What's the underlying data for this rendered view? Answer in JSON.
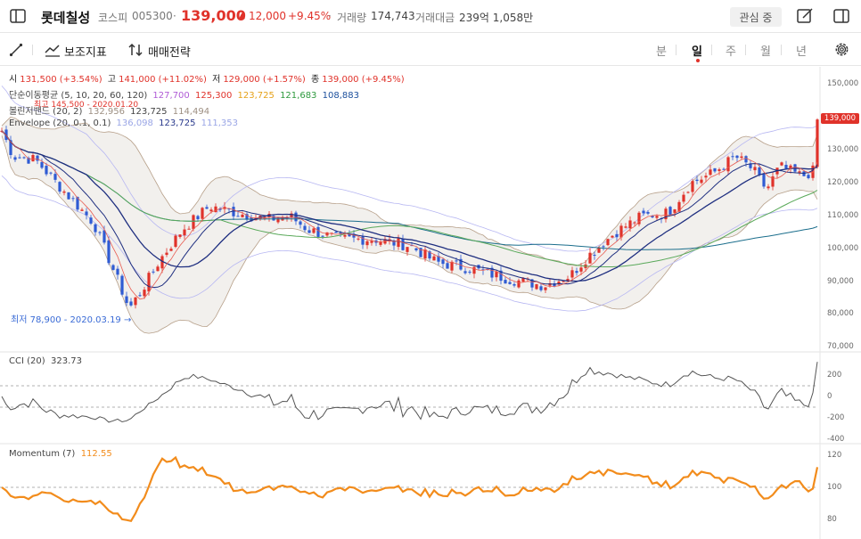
{
  "header": {
    "stock_name": "롯데칠성",
    "market": "코스피",
    "code": "005300",
    "separator": "·",
    "price": "139,000",
    "change_arrow": "▲",
    "change": "12,000",
    "change_pct": "+9.45%",
    "volume_label": "거래량",
    "volume": "174,743",
    "amount_label": "거래대금",
    "amount": "239억 1,058만",
    "watch_button": "관심 중"
  },
  "toolbar": {
    "indicator_label": "보조지표",
    "strategy_label": "매매전략",
    "periods": [
      "분",
      "일",
      "주",
      "월",
      "년"
    ],
    "active_period": "일"
  },
  "legend": {
    "ohlc": {
      "open_label": "시",
      "open": "131,500 (+3.54%)",
      "high_label": "고",
      "high": "141,000 (+11.02%)",
      "low_label": "저",
      "low": "129,000 (+1.57%)",
      "close_label": "종",
      "close": "139,000 (+9.45%)"
    },
    "ma": {
      "label": "단순이동평균 (5, 10, 20, 60, 120)",
      "v5": "127,700",
      "v10": "125,300",
      "v20": "123,725",
      "v60": "121,683",
      "v120": "108,883"
    },
    "bollinger": {
      "label": "볼린저밴드 (20, 2)",
      "upper": "132,956",
      "mid": "123,725",
      "lower": "114,494"
    },
    "envelope": {
      "label": "Envelope (20, 0.1, 0.1)",
      "upper": "136,098",
      "mid": "123,725",
      "lower": "111,353"
    },
    "max_label": "최고 145,500 - 2020.01.20",
    "min_label": "최저 78,900 - 2020.03.19 →"
  },
  "price_axis": [
    "150,000",
    "140,000",
    "130,000",
    "120,000",
    "110,000",
    "100,000",
    "90,000",
    "80,000",
    "70,000"
  ],
  "current_price_tag": "139,000",
  "cci": {
    "label": "CCI (20)",
    "value": "323.73",
    "axis": [
      "200",
      "0",
      "-200",
      "-400"
    ]
  },
  "momentum": {
    "label": "Momentum (7)",
    "value": "112.55",
    "axis": [
      "120",
      "100",
      "80"
    ]
  },
  "colors": {
    "up": "#e0322a",
    "down": "#2f5bd3",
    "ma5": "#e0322a",
    "ma10": "#1f2f80",
    "ma20": "#5aa95a",
    "ma60": "#1b6e8c",
    "momentum": "#f28c1c",
    "bollinger": "#b7a08a",
    "envelope": "#b7b7f2"
  }
}
